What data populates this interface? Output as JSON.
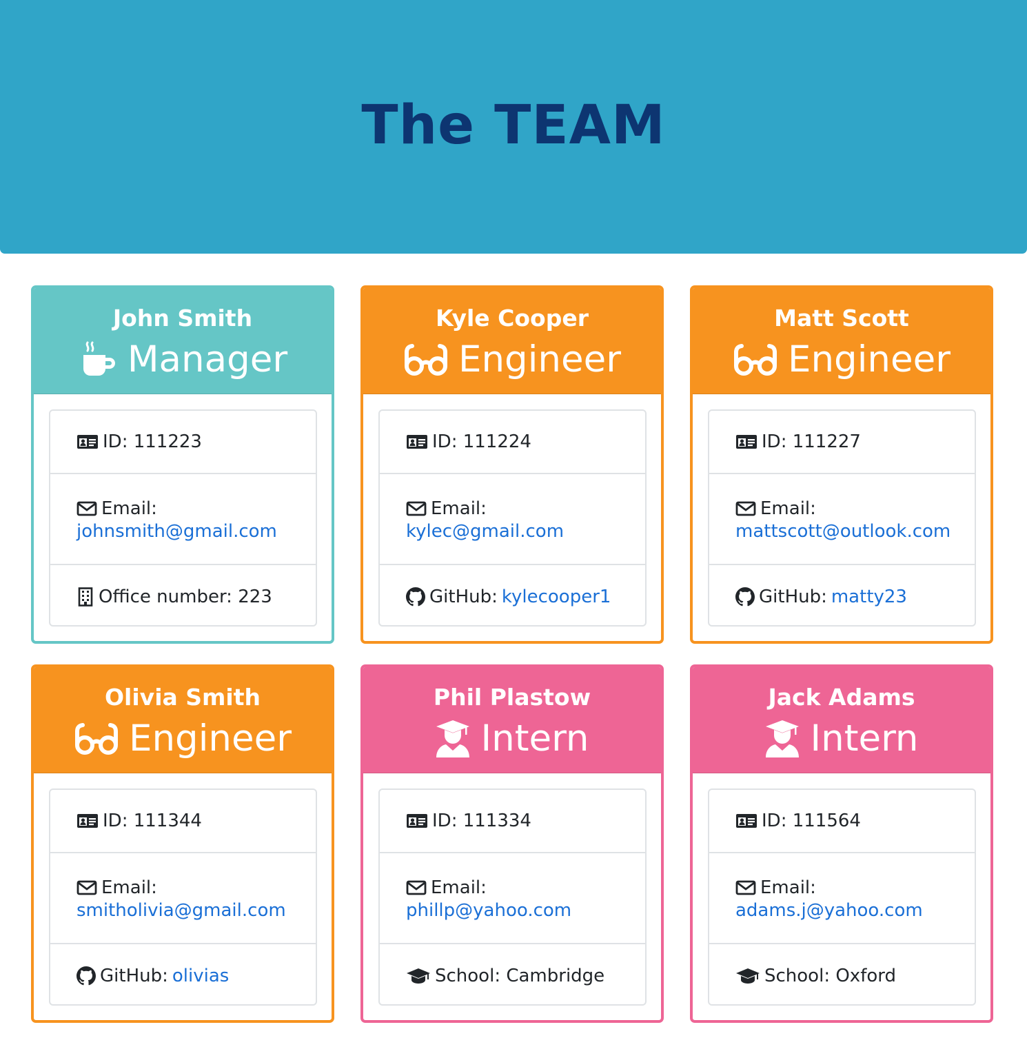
{
  "header": {
    "title": "The TEAM"
  },
  "colors": {
    "jumbotron": "#30a5c8",
    "title": "#0d3571",
    "manager": "#65c6c6",
    "engineer": "#f7931f",
    "intern": "#ee6595",
    "link": "#1a6fd6"
  },
  "labels": {
    "email": "Email:",
    "github": "GitHub:",
    "office": "Office number:",
    "school": "School:",
    "id": "ID:"
  },
  "employees": [
    {
      "name": "John Smith",
      "role": "Manager",
      "role_icon": "mug-hot-icon",
      "id": "ID: 111223",
      "email": "johnsmith@gmail.com",
      "extra_label": "Office number: 223",
      "extra_link": "",
      "extra_icon": "building-icon"
    },
    {
      "name": "Kyle Cooper",
      "role": "Engineer",
      "role_icon": "glasses-icon",
      "id": "ID: 111224",
      "email": "kylec@gmail.com",
      "extra_label": "GitHub:",
      "extra_link": "kylecooper1",
      "extra_icon": "github-icon"
    },
    {
      "name": "Matt Scott",
      "role": "Engineer",
      "role_icon": "glasses-icon",
      "id": "ID: 111227",
      "email": "mattscott@outlook.com",
      "extra_label": "GitHub:",
      "extra_link": "matty23",
      "extra_icon": "github-icon"
    },
    {
      "name": "Olivia Smith",
      "role": "Engineer",
      "role_icon": "glasses-icon",
      "id": "ID: 111344",
      "email": "smitholivia@gmail.com",
      "extra_label": "GitHub:",
      "extra_link": "olivias",
      "extra_icon": "github-icon"
    },
    {
      "name": "Phil Plastow",
      "role": "Intern",
      "role_icon": "user-graduate-icon",
      "id": "ID: 111334",
      "email": "phillp@yahoo.com",
      "extra_label": "School: Cambridge",
      "extra_link": "",
      "extra_icon": "graduation-cap-icon"
    },
    {
      "name": "Jack Adams",
      "role": "Intern",
      "role_icon": "user-graduate-icon",
      "id": "ID: 111564",
      "email": "adams.j@yahoo.com",
      "extra_label": "School: Oxford",
      "extra_link": "",
      "extra_icon": "graduation-cap-icon"
    }
  ]
}
